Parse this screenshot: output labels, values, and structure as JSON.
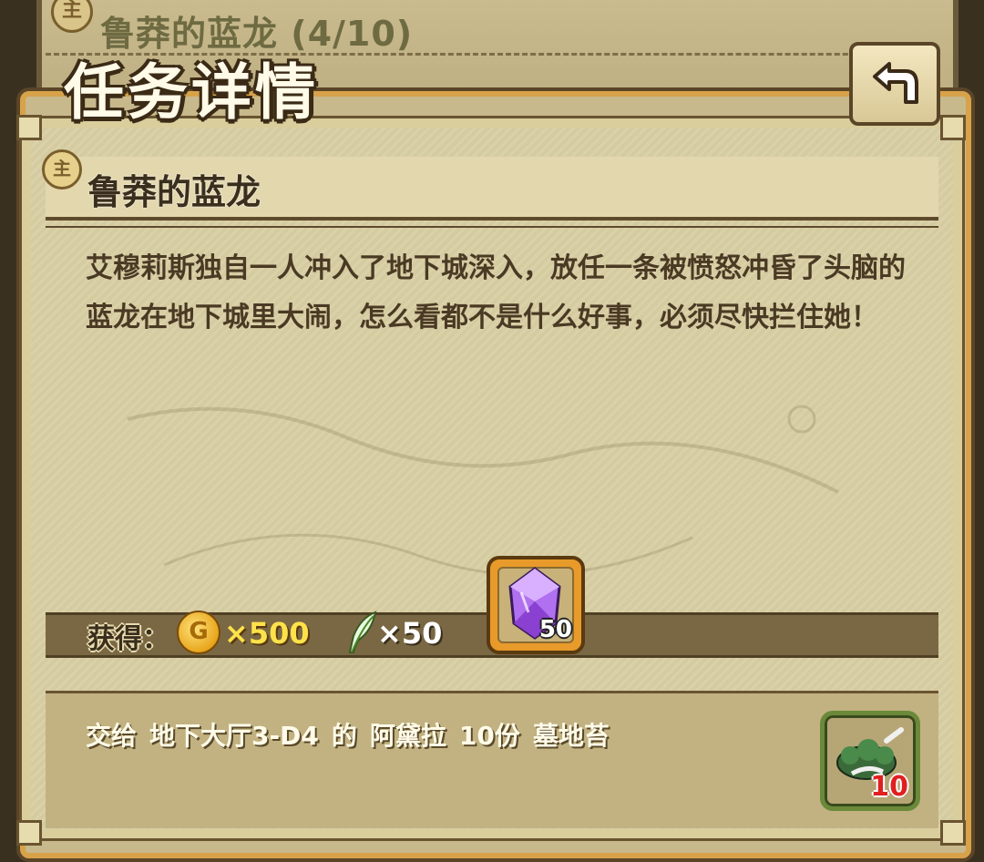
{
  "background_list": {
    "badge": "主",
    "title": "鲁莽的蓝龙 (4/10)"
  },
  "page_title": "任务详情",
  "quest": {
    "badge": "主",
    "title": "鲁莽的蓝龙",
    "description": "艾穆莉斯独自一人冲入了地下城深入，放任一条被愤怒冲昏了头脑的蓝龙在地下城里大闹，怎么看都不是什么好事，必须尽快拦住她！"
  },
  "rewards": {
    "label": "获得：",
    "gold": {
      "icon": "gold-coin-icon",
      "symbol": "G",
      "amount": "×500"
    },
    "feather": {
      "icon": "feather-icon",
      "amount": "×50"
    },
    "crystal": {
      "icon": "purple-crystal-icon",
      "count": "50"
    }
  },
  "objective": {
    "verb": "交给",
    "location": "地下大厅3-D4",
    "particle": "的",
    "npc": "阿黛拉",
    "quantity": "10份",
    "item": "墓地苔",
    "item_icon": "graveyard-moss-icon",
    "item_count": "10"
  },
  "colors": {
    "gold_text": "#ffe24a",
    "frame_orange": "#e89a2a",
    "count_red": "#e02020"
  }
}
